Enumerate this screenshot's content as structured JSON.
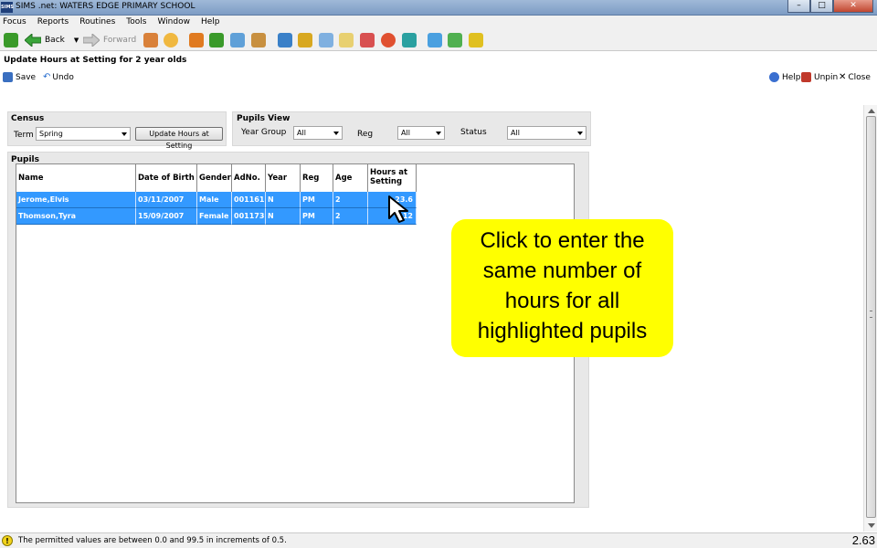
{
  "window": {
    "app_icon_text": "SIMS",
    "title": "SIMS .net: WATERS EDGE PRIMARY SCHOOL",
    "controls": {
      "minimize": "–",
      "maximize": "□",
      "close": "✕"
    }
  },
  "menu": [
    "Focus",
    "Reports",
    "Routines",
    "Tools",
    "Window",
    "Help"
  ],
  "toolbar": {
    "back_label": "Back",
    "forward_label": "Forward",
    "icons": [
      "refresh-icon",
      "back-icon",
      "forward-icon",
      "people-icon",
      "person-icon",
      "book-icon",
      "flag-icon",
      "card-icon",
      "teacher-icon",
      "chart-icon",
      "report-icon",
      "document-icon",
      "edit-icon",
      "group-icon",
      "clock-icon",
      "tool-icon",
      "note-icon",
      "export-icon",
      "export2-icon"
    ]
  },
  "panel": {
    "title": "Update Hours at Setting for 2 year olds",
    "save_label": "Save",
    "undo_label": "Undo",
    "help_label": "Help",
    "unpin_label": "Unpin",
    "close_label": "Close"
  },
  "census": {
    "group_title": "Census",
    "term_label": "Term",
    "term_value": "Spring",
    "update_button": "Update Hours at Setting"
  },
  "pupils_view": {
    "group_title": "Pupils View",
    "year_group_label": "Year Group",
    "year_group_value": "All",
    "reg_label": "Reg",
    "reg_value": "All",
    "status_label": "Status",
    "status_value": "All"
  },
  "pupils": {
    "group_title": "Pupils",
    "columns": [
      "Name",
      "Date of Birth",
      "Gender",
      "AdNo.",
      "Year",
      "Reg",
      "Age",
      "Hours at Setting"
    ],
    "rows": [
      {
        "name": "Jerome,Elvis",
        "dob": "03/11/2007",
        "gender": "Male",
        "adno": "001161",
        "year": "N",
        "reg": "PM",
        "age": "2",
        "hours": "23.6"
      },
      {
        "name": "Thomson,Tyra",
        "dob": "15/09/2007",
        "gender": "Female",
        "adno": "001173",
        "year": "N",
        "reg": "PM",
        "age": "2",
        "hours": "12"
      }
    ]
  },
  "callout": {
    "line1": "Click to enter the",
    "line2": "same number of",
    "line3": "hours for all",
    "line4": "highlighted pupils"
  },
  "status": {
    "warn_symbol": "!",
    "text": "The permitted values are between 0.0 and 99.5 in increments of 0.5.",
    "page_number": "2.63"
  },
  "colors": {
    "selection": "#3399ff",
    "callout": "#ffff00",
    "panel_bg": "#e8e8e8"
  }
}
